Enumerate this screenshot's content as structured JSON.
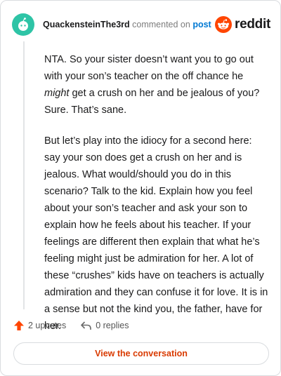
{
  "header": {
    "username": "QuackensteinThe3rd",
    "action_text": "commented on",
    "post_link": "post",
    "brand": "reddit"
  },
  "comment": {
    "p1_before": "NTA. So your sister doesn’t want you to go out with your son’s teacher on the off chance he ",
    "p1_emphasis": "might",
    "p1_after": " get a crush on her and be jealous of you? Sure. That’s sane.",
    "p2": "But let’s play into the idiocy for a second here: say your son does get a crush on her and is jealous. What would/should you do in this scenario? Talk to the kid. Explain how you feel about your son’s teacher and ask your son to explain how he feels about his teacher. If your feelings are different then explain that what he’s feeling might just be admiration for her. A lot of these “crushes” kids have on teachers is actually admiration and they can confuse it for love. It is in a sense but not the kind you, the father, have for her."
  },
  "actions": {
    "upvotes": "2 upvotes",
    "replies": "0 replies"
  },
  "cta": {
    "label": "View the conversation"
  },
  "colors": {
    "accent": "#ff4500",
    "link": "#0079d3",
    "cta_text": "#d93a00",
    "avatar": "#2ec4a6"
  },
  "icons": {
    "avatar": "snoo-avatar-icon",
    "logo": "reddit-snoo-icon",
    "upvote": "upvote-arrow-icon",
    "reply": "reply-arrow-icon"
  }
}
